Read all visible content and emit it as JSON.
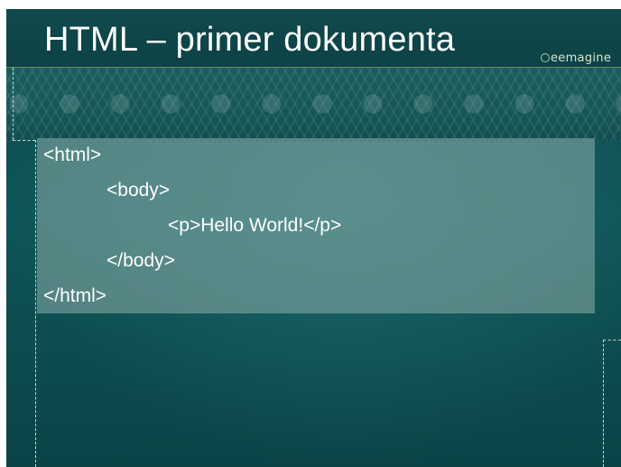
{
  "slide": {
    "title": "HTML – primer dokumenta",
    "logo_text": "eemagine",
    "code_lines": [
      "<html>",
      "<body>",
      "<p>Hello World!</p>",
      "</body>",
      "</html>"
    ]
  },
  "colors": {
    "background": "#0f5558",
    "code_box": "#8cafaa",
    "title_text": "#ffffff",
    "rule": "#6f8a5e"
  },
  "icons": {
    "logo": "eemagine-logo-icon"
  }
}
